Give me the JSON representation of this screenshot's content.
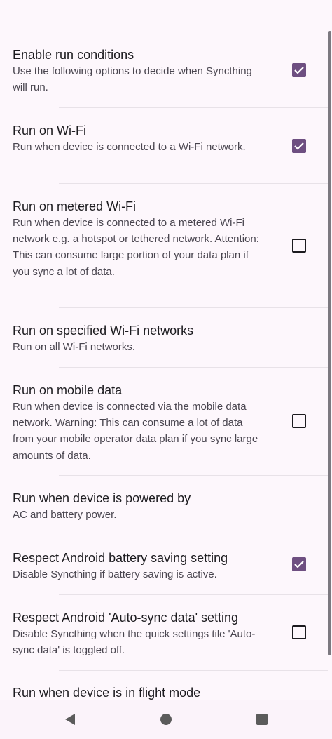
{
  "colors": {
    "background": "#fdf7fc",
    "checkbox_checked": "#6e4f81",
    "checkbox_unchecked_border": "#1c1b1f",
    "summary_text": "#49454f"
  },
  "settings": [
    {
      "title": "Enable run conditions",
      "summary": "Use the following options to decide when Syncthing will run.",
      "checkbox": true
    },
    {
      "title": "Run on Wi-Fi",
      "summary": "Run when device is connected to a Wi-Fi network.",
      "checkbox": true
    },
    {
      "title": "Run on metered Wi-Fi",
      "summary": "Run when device is connected to a metered Wi-Fi network e.g. a hotspot or tethered network. Attention: This can consume large portion of your data plan if you sync a lot of data.",
      "checkbox": false
    },
    {
      "title": "Run on specified Wi-Fi networks",
      "summary": "Run on all Wi-Fi networks."
    },
    {
      "title": "Run on mobile data",
      "summary": "Run when device is connected via the mobile data network. Warning: This can consume a lot of data from your mobile operator data plan if you sync large amounts of data.",
      "checkbox": false
    },
    {
      "title": "Run when device is powered by",
      "summary": "AC and battery power."
    },
    {
      "title": "Respect Android battery saving setting",
      "summary": "Disable Syncthing if battery saving is active.",
      "checkbox": true
    },
    {
      "title": "Respect Android 'Auto-sync data' setting",
      "summary": "Disable Syncthing when the quick settings tile 'Auto-sync data' is toggled off.",
      "checkbox": false
    },
    {
      "title": "Run when device is in flight mode"
    }
  ],
  "nav": {
    "back_icon": "back-triangle",
    "home_icon": "home-circle",
    "recents_icon": "recents-square"
  }
}
